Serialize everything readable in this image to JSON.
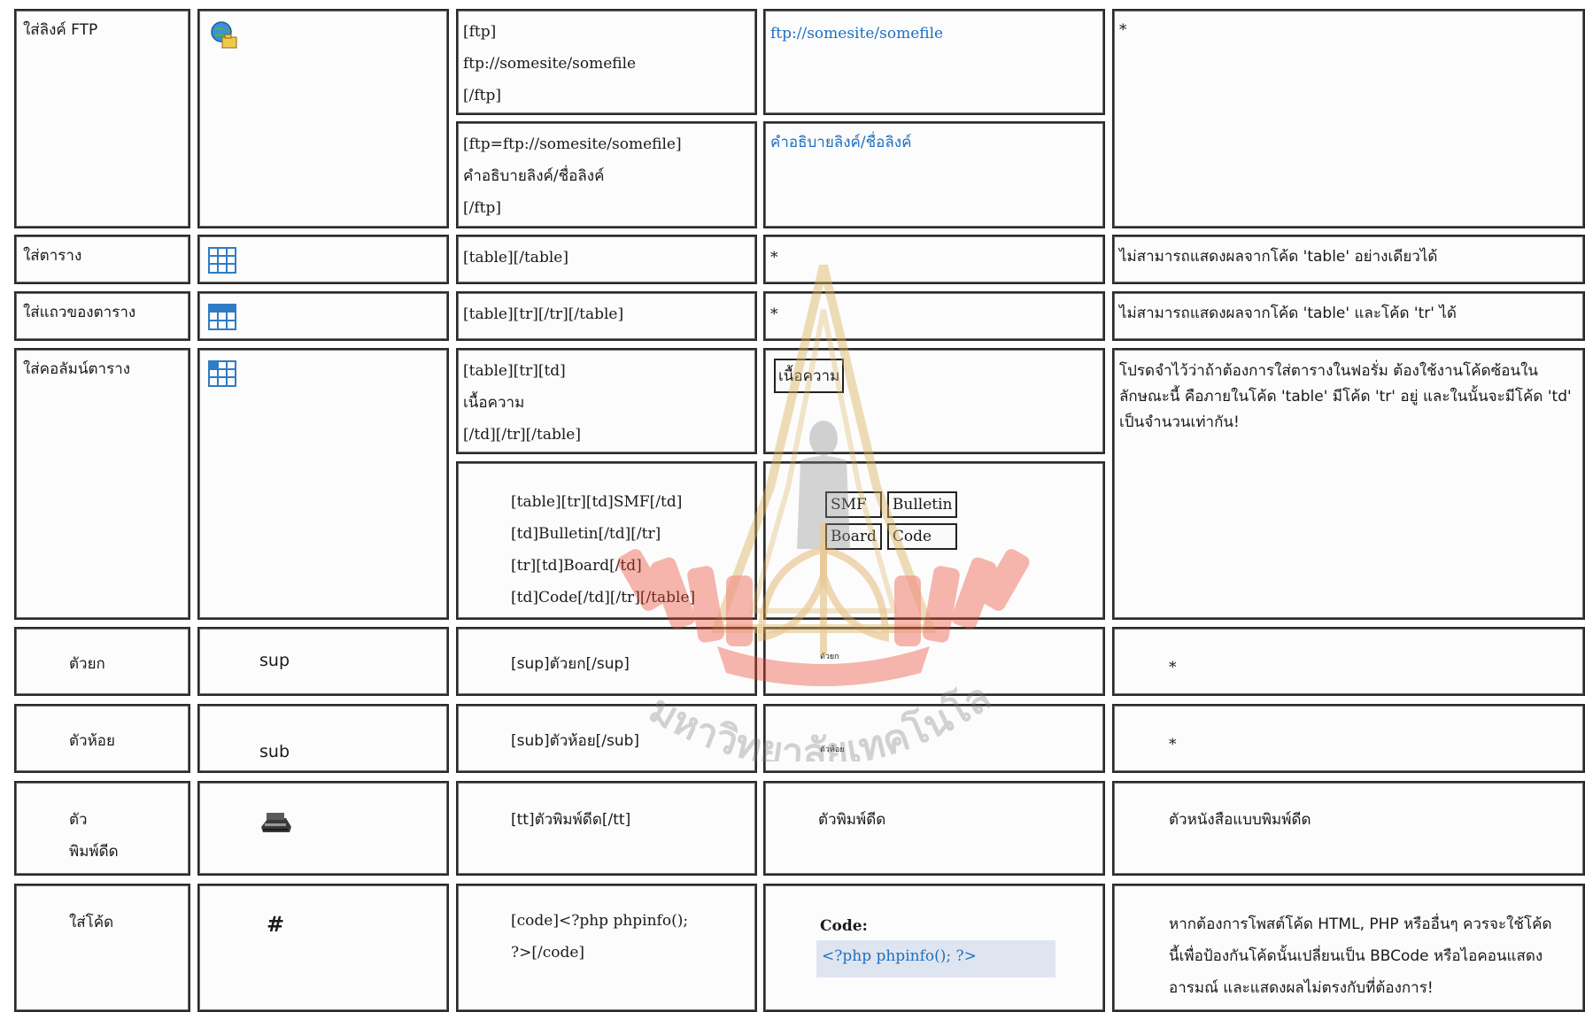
{
  "rows": {
    "ftp": {
      "label": "ใส่ลิงค์ FTP",
      "icon": "ftp-globe-icon",
      "code1": [
        "[ftp]",
        "ftp://somesite/somefile",
        "[/ftp]"
      ],
      "result1": "ftp://somesite/somefile",
      "code2": [
        "[ftp=ftp://somesite/somefile]",
        "คำอธิบายลิงค์/ชื่อลิงค์",
        "[/ftp]"
      ],
      "result2": "คำอธิบายลิงค์/ชื่อลิงค์",
      "note": "*"
    },
    "table": {
      "label": "ใส่ตาราง",
      "icon": "table-grid-icon",
      "code": "[table][/table]",
      "result": "*",
      "note": "ไม่สามารถแสดงผลจากโค้ด 'table' อย่างเดียวได้"
    },
    "tr": {
      "label": "ใส่แถวของตาราง",
      "icon": "table-row-icon",
      "code": "[table][tr][/tr][/table]",
      "result": "*",
      "note": "ไม่สามารถแสดงผลจากโค้ด 'table' และโค้ด 'tr' ได้"
    },
    "td": {
      "label": "ใส่คอลัมน์ตาราง",
      "icon": "table-column-icon",
      "code1": [
        "[table][tr][td]",
        "เนื้อความ",
        "[/td][/tr][/table]"
      ],
      "result1": "เนื้อความ",
      "code2": [
        "[table][tr][td]SMF[/td]",
        "[td]Bulletin[/td][/tr]",
        "[tr][td]Board[/td]",
        "[td]Code[/td][/tr][/table]"
      ],
      "result2": [
        [
          "SMF",
          "Bulletin"
        ],
        [
          "Board",
          "Code"
        ]
      ],
      "note": "โปรดจำไว้ว่าถ้าต้องการใส่ตารางในฟอรั่ม ต้องใช้งานโค้ดซ้อนในลักษณะนี้ คือภายในโค้ด 'table' มีโค้ด 'tr' อยู่ และในนั้นจะมีโค้ด 'td' เป็นจำนวนเท่ากัน!"
    },
    "sup": {
      "label": "ตัวยก",
      "icon_text": "sup",
      "code": "[sup]ตัวยก[/sup]",
      "result": "ตัวยก",
      "note": "*"
    },
    "sub": {
      "label": "ตัวห้อย",
      "icon_text": "sub",
      "code": "[sub]ตัวห้อย[/sub]",
      "result": "ตัวห้อย",
      "note": "*"
    },
    "tt": {
      "label_line1": "ตัว",
      "label_line2": "พิมพ์ดีด",
      "icon": "typewriter-icon",
      "code": "[tt]ตัวพิมพ์ดีด[/tt]",
      "result": "ตัวพิมพ์ดีด",
      "note": "ตัวหนังสือแบบพิมพ์ดีด"
    },
    "code": {
      "label": "ใส่โค้ด",
      "icon_text": "#",
      "code": [
        "[code]<?php phpinfo();",
        "?>[/code]"
      ],
      "result_label": "Code:",
      "result_code": "<?php phpinfo(); ?>",
      "note": "หากต้องการโพสต์โค้ด HTML, PHP หรืออื่นๆ ควรจะใช้โค้ดนี้เพื่อป้องกันโค้ดนั้นเปลี่ยนเป็น BBCode หรือไอคอนแสดงอารมณ์ และแสดงผลไม่ตรงกับที่ต้องการ!"
    }
  },
  "watermark_text": "มหาวิทยาลัยเทคโนโลยีสุรนารี",
  "colors": {
    "link": "#1e6fc0",
    "watermark": "#e8452b",
    "watermark_gold": "#d9b15a"
  }
}
